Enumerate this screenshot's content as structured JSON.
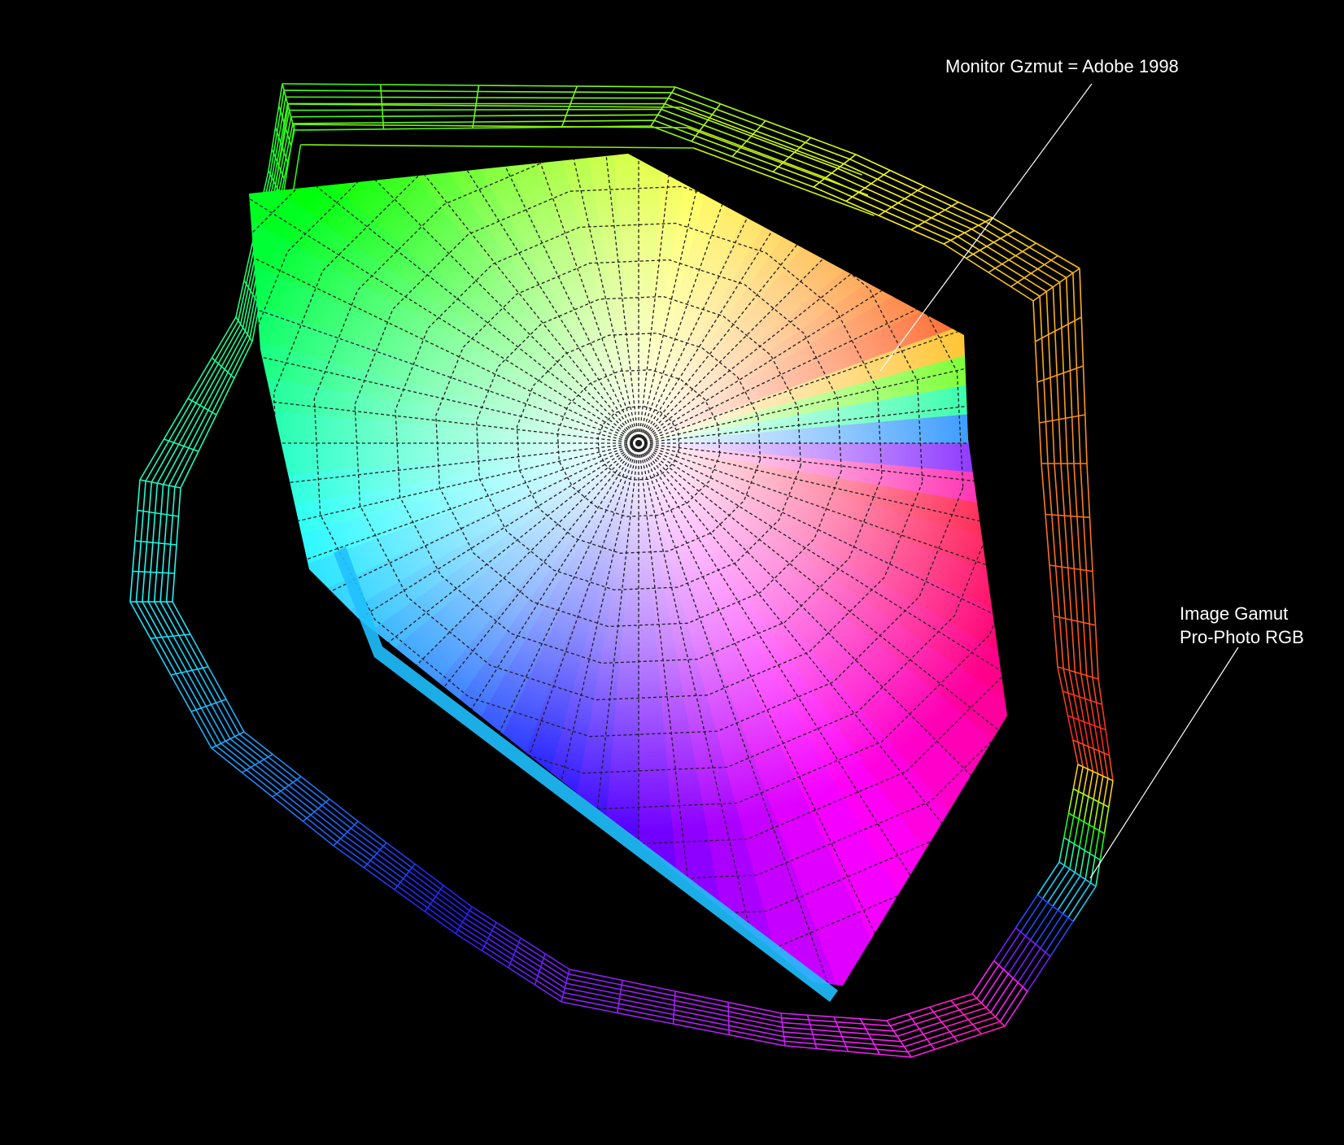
{
  "annotations": {
    "monitor_gamut": {
      "text": "Monitor Gzmut = Adobe 1998"
    },
    "image_gamut": {
      "line1": "Image Gamut",
      "line2": "Pro-Photo RGB"
    }
  },
  "colors": {
    "background": "#000000",
    "label": "#ffffff",
    "leader_line": "#ffffff",
    "hue_wheel": [
      "#00ff00",
      "#ffff00",
      "#ff8000",
      "#ff0000",
      "#ff00ff",
      "#8000ff",
      "#0000ff",
      "#00ffff"
    ],
    "center_white": "#ffffff"
  },
  "legend": [
    {
      "label_ref": "annotations.monitor_gamut.text",
      "glyph": "solid-surface"
    },
    {
      "label_ref": "annotations.image_gamut",
      "glyph": "wireframe-mesh"
    }
  ]
}
